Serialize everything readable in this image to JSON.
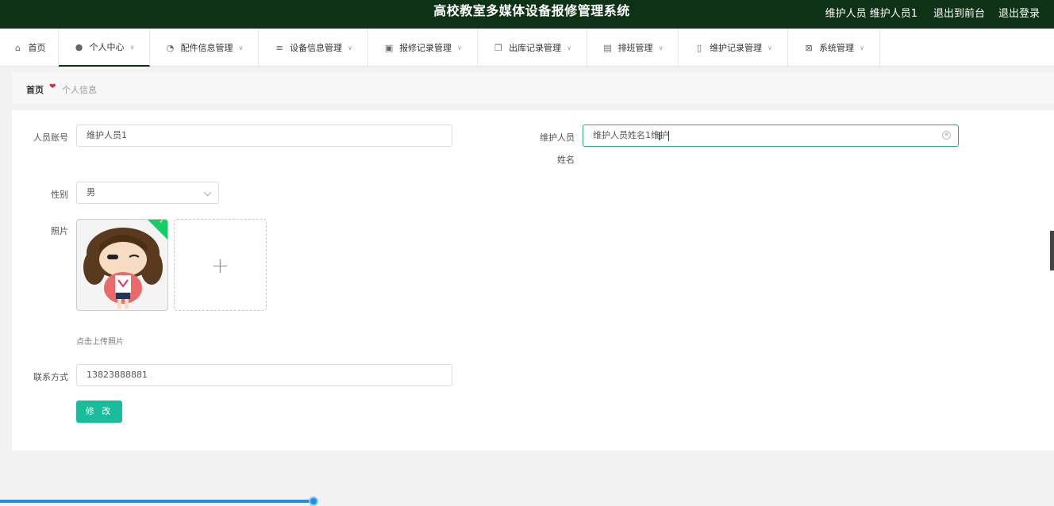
{
  "header": {
    "title": "高校教室多媒体设备报修管理系统",
    "user_role": "维护人员",
    "user_name": "维护人员1",
    "to_front": "退出到前台",
    "logout": "退出登录",
    "background_color": "#0d3216"
  },
  "nav": {
    "items": [
      {
        "label": "首页",
        "icon": "home-icon"
      },
      {
        "label": "个人中心",
        "icon": "user-icon"
      },
      {
        "label": "配件信息管理",
        "icon": "dashboard-icon"
      },
      {
        "label": "设备信息管理",
        "icon": "list-icon"
      },
      {
        "label": "报修记录管理",
        "icon": "clipboard-icon"
      },
      {
        "label": "出库记录管理",
        "icon": "copy-icon"
      },
      {
        "label": "排班管理",
        "icon": "document-icon"
      },
      {
        "label": "维护记录管理",
        "icon": "microphone-icon"
      },
      {
        "label": "系统管理",
        "icon": "clipboard-x-icon"
      }
    ],
    "active": "个人中心"
  },
  "breadcrumb": {
    "home": "首页",
    "current": "个人信息"
  },
  "form": {
    "account_label": "人员账号",
    "account_value": "维护人员1",
    "name_label_line1": "维护人员",
    "name_label_line2": "姓名",
    "name_value": "维护人员姓名1维护",
    "gender_label": "性别",
    "gender_value": "男",
    "photo_label": "照片",
    "upload_tip": "点击上传照片",
    "contact_label": "联系方式",
    "contact_value": "13823888881",
    "submit_label": "修 改"
  },
  "colors": {
    "accent": "#1abc9c",
    "focus_border": "#31a47c",
    "heart": "#e5262d",
    "progress": "#1e90e8"
  }
}
